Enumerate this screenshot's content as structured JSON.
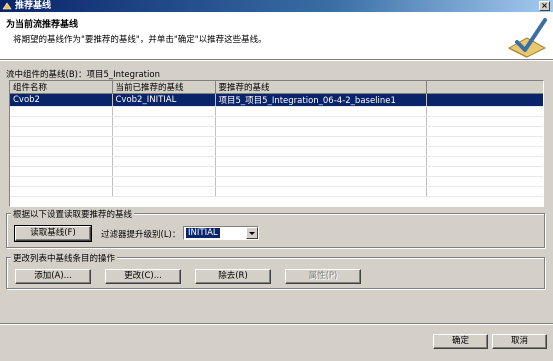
{
  "window": {
    "title": "推荐基线"
  },
  "header": {
    "title": "为当前流推荐基线",
    "description": "将期望的基线作为\"要推荐的基线\"，并单击\"确定\"以推荐这些基线。"
  },
  "stream_label": "流中组件的基线(B)：项目5_Integration",
  "table": {
    "columns": [
      "组件名称",
      "当前已推荐的基线",
      "要推荐的基线",
      ""
    ],
    "rows": [
      {
        "component": "Cvob2",
        "current": "Cvob2_INITIAL",
        "recommend": "项目5_项目5_Integration_06-4-2_baseline1"
      }
    ]
  },
  "settings_group": {
    "legend": "根据以下设置读取要推荐的基线",
    "read_button": "读取基线(F)",
    "filter_label": "过滤器提升级别(L)：",
    "filter_value": "INITIAL"
  },
  "actions_group": {
    "legend": "更改列表中基线条目的操作",
    "add": "添加(A)...",
    "change": "更改(C)...",
    "remove": "除去(R)",
    "properties": "属性(P)"
  },
  "footer": {
    "ok": "确定",
    "cancel": "取消"
  }
}
